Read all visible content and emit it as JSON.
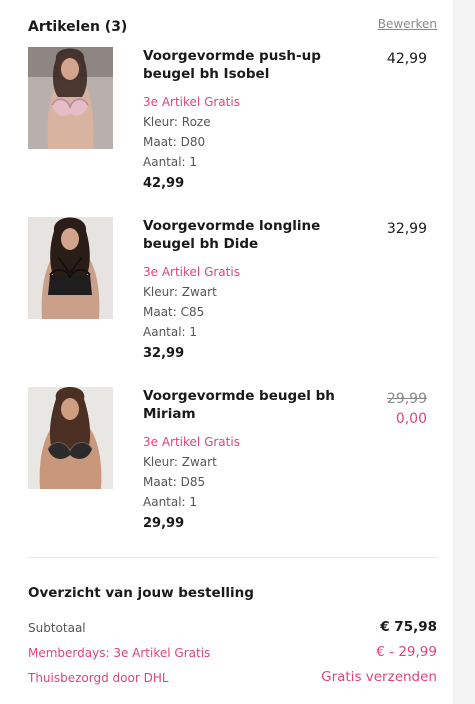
{
  "header": {
    "title": "Artikelen (3)",
    "edit_label": "Bewerken"
  },
  "items": [
    {
      "name": "Voorgevormde push-up beugel bh Isobel",
      "promo": "3e Artikel Gratis",
      "color": "Kleur: Roze",
      "size": "Maat: D80",
      "quantity": "Aantal: 1",
      "line_price": "42,99",
      "price": "42,99"
    },
    {
      "name": "Voorgevormde longline beugel bh Dide",
      "promo": "3e Artikel Gratis",
      "color": "Kleur: Zwart",
      "size": "Maat: C85",
      "quantity": "Aantal: 1",
      "line_price": "32,99",
      "price": "32,99"
    },
    {
      "name": "Voorgevormde beugel bh Miriam",
      "promo": "3e Artikel Gratis",
      "color": "Kleur: Zwart",
      "size": "Maat: D85",
      "quantity": "Aantal: 1",
      "line_price": "29,99",
      "old_price": "29,99",
      "new_price": "0,00"
    }
  ],
  "summary": {
    "title": "Overzicht van jouw bestelling",
    "subtotal_label": "Subtotaal",
    "subtotal_value": "€ 75,98",
    "discount_label": "Memberdays: 3e Artikel Gratis",
    "discount_value": "€ - 29,99",
    "shipping_label": "Thuisbezorgd door DHL",
    "shipping_value": "Gratis verzenden"
  },
  "colors": {
    "accent": "#e0447a",
    "text": "#1a1a1a",
    "muted": "#8a8a8a"
  }
}
